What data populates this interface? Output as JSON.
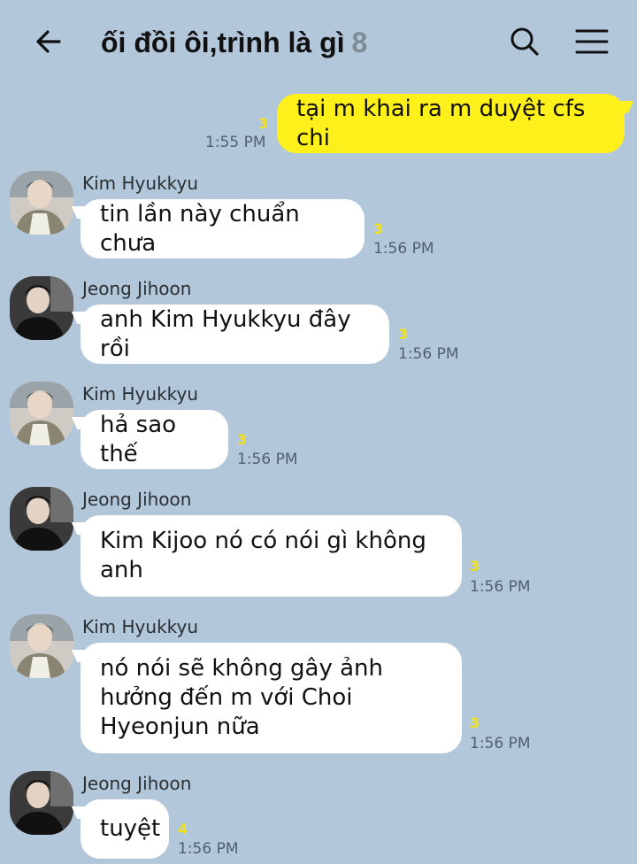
{
  "header": {
    "title": "ối đồi ôi,trình là gì",
    "member_count": "8",
    "back_icon": "arrow-left-icon",
    "search_icon": "search-icon",
    "menu_icon": "hamburger-menu-icon"
  },
  "colors": {
    "background": "#b2c7da",
    "my_bubble": "#fef01b",
    "their_bubble": "#ffffff",
    "unread": "#f2e01b"
  },
  "messages": [
    {
      "sender": "",
      "text": "tại m khai ra m duyệt cfs chi",
      "unread": "3",
      "time": "1:55 PM"
    },
    {
      "sender": "Kim Hyukkyu",
      "text": "tin lần này chuẩn chưa",
      "unread": "3",
      "time": "1:56 PM"
    },
    {
      "sender": "Jeong Jihoon",
      "text": "anh Kim Hyukkyu đây rồi",
      "unread": "3",
      "time": "1:56 PM"
    },
    {
      "sender": "Kim Hyukkyu",
      "text": "hả sao thế",
      "unread": "3",
      "time": "1:56 PM"
    },
    {
      "sender": "Jeong Jihoon",
      "lines": [
        "Kim Kijoo nó có nói gì không",
        "anh"
      ],
      "unread": "3",
      "time": "1:56 PM"
    },
    {
      "sender": "Kim Hyukkyu",
      "lines": [
        "nó nói sẽ không gây ảnh",
        "hưởng đến m với Choi",
        "Hyeonjun nữa"
      ],
      "unread": "3",
      "time": "1:56 PM"
    },
    {
      "sender": "Jeong Jihoon",
      "text": "tuyệt",
      "unread": "4",
      "time": "1:56 PM"
    }
  ]
}
